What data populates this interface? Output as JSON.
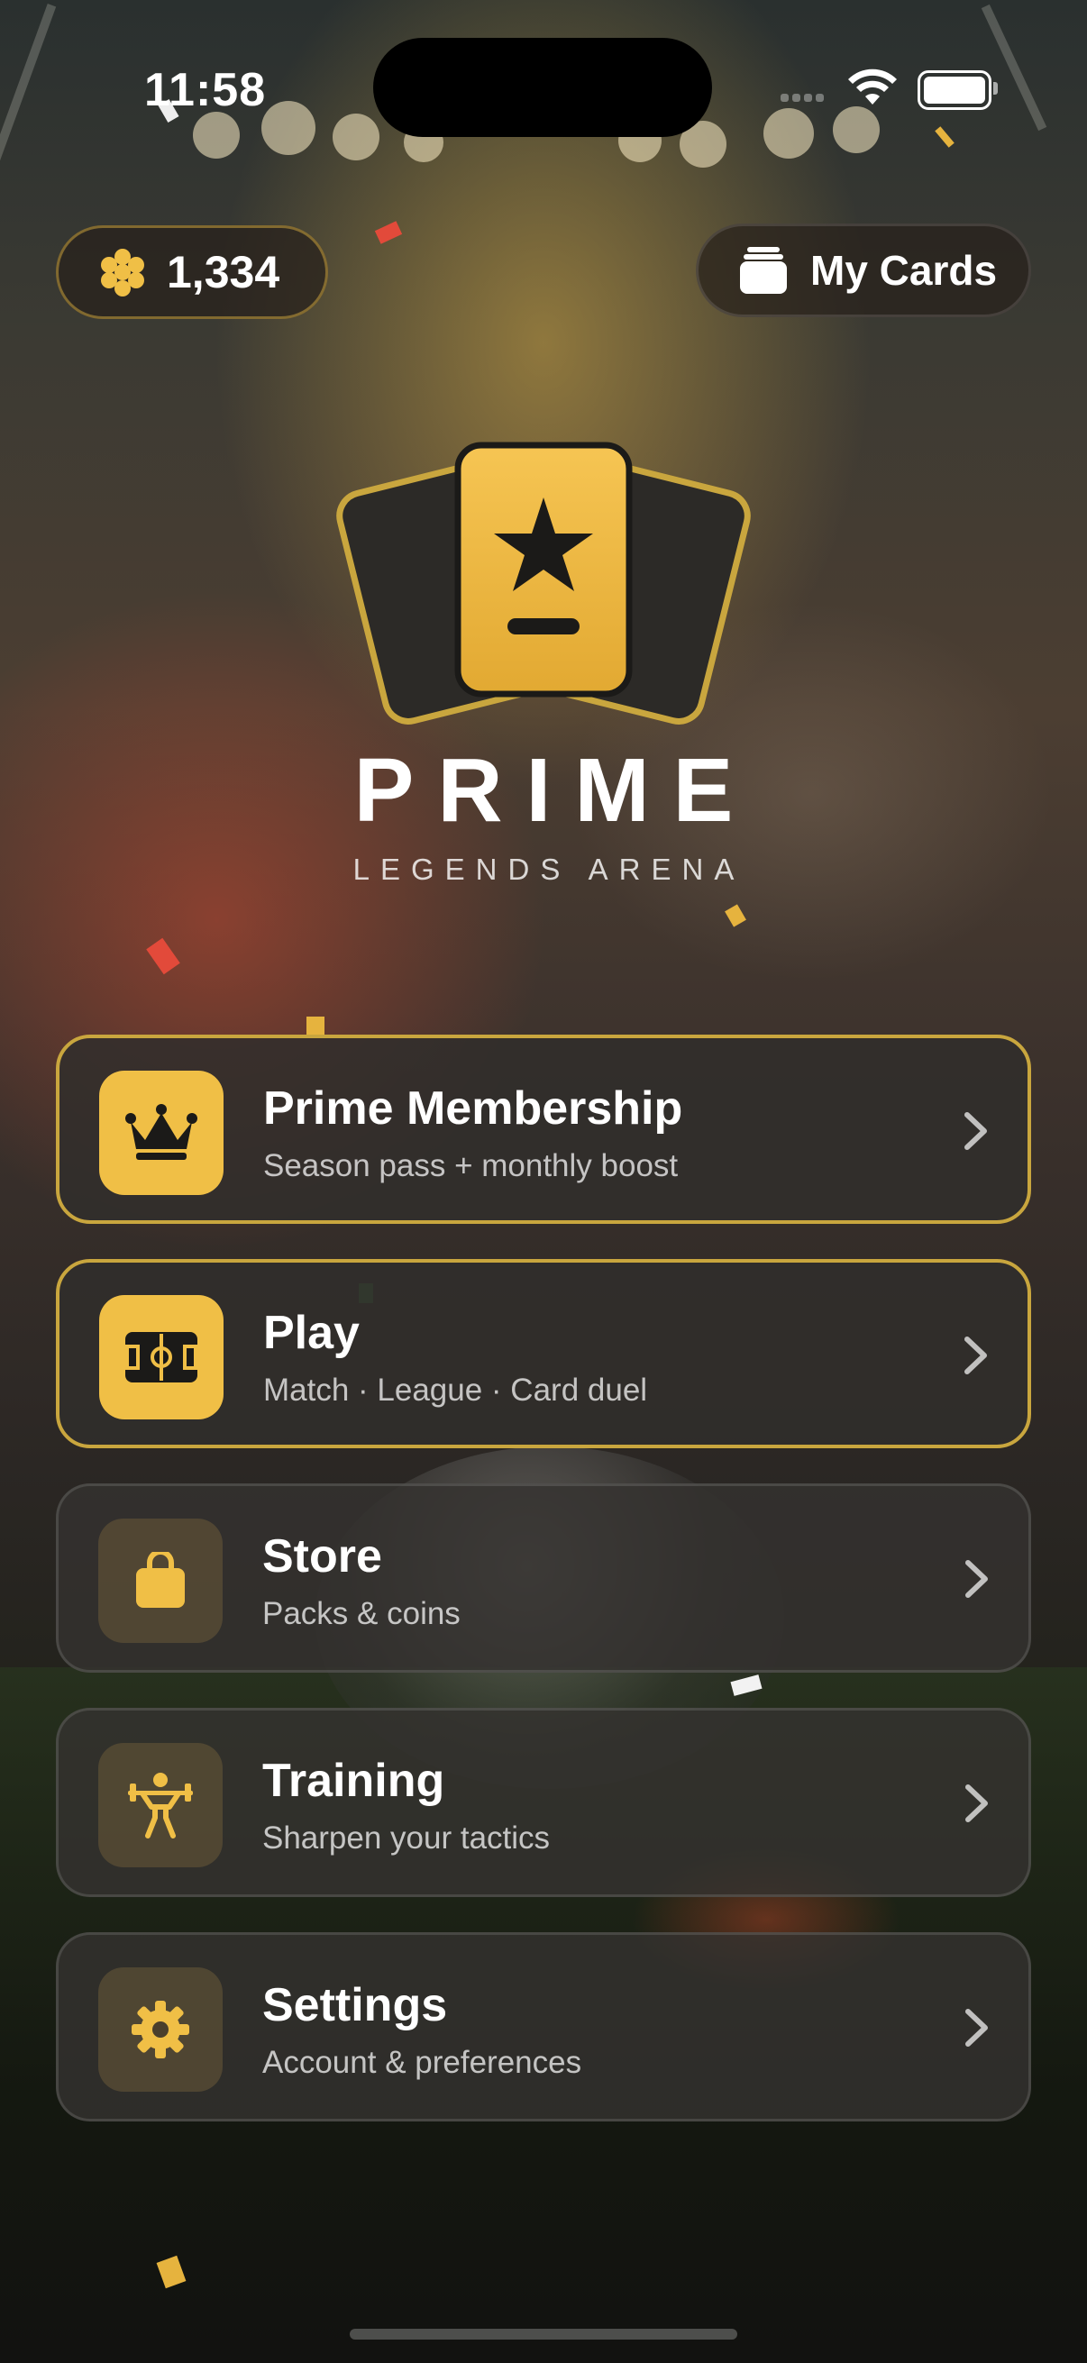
{
  "status_bar": {
    "time": "11:58"
  },
  "header": {
    "coin_balance": "1,334",
    "coin_icon": "coins-icon",
    "my_cards_label": "My Cards",
    "my_cards_icon": "cards-stack-icon"
  },
  "brand": {
    "title": "PRIME",
    "subtitle": "LEGENDS ARENA",
    "logo_icon": "star-card-icon"
  },
  "menu": [
    {
      "title": "Prime Membership",
      "subtitle": "Season pass + monthly boost",
      "icon": "crown-icon",
      "featured": true
    },
    {
      "title": "Play",
      "subtitle": "Match · League · Card duel",
      "icon": "soccer-field-icon",
      "featured": true
    },
    {
      "title": "Store",
      "subtitle": "Packs & coins",
      "icon": "shopping-bag-icon",
      "featured": false
    },
    {
      "title": "Training",
      "subtitle": "Sharpen your tactics",
      "icon": "weightlifter-icon",
      "featured": false
    },
    {
      "title": "Settings",
      "subtitle": "Account & preferences",
      "icon": "gear-icon",
      "featured": false
    }
  ],
  "colors": {
    "accent": "#f0bf46",
    "accent_border": "#c9a63e",
    "card_bg": "#2f2d2b"
  }
}
